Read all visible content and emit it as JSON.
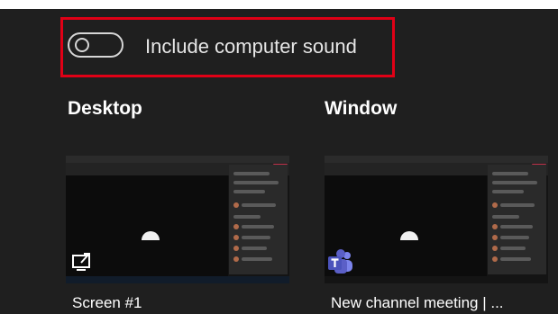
{
  "sound_toggle": {
    "label": "Include computer sound",
    "state": "off",
    "highlight_color": "#e00016"
  },
  "sections": {
    "desktop_title": "Desktop",
    "window_title": "Window"
  },
  "sources": [
    {
      "caption": "Screen #1",
      "icon": "share-screen-icon"
    },
    {
      "caption": "New channel meeting | ...",
      "icon": "teams-icon"
    }
  ],
  "colors": {
    "background": "#1f1f1f",
    "text": "#ffffff",
    "teams_purple": "#5b5fc7",
    "leave_red": "#c4314b"
  }
}
